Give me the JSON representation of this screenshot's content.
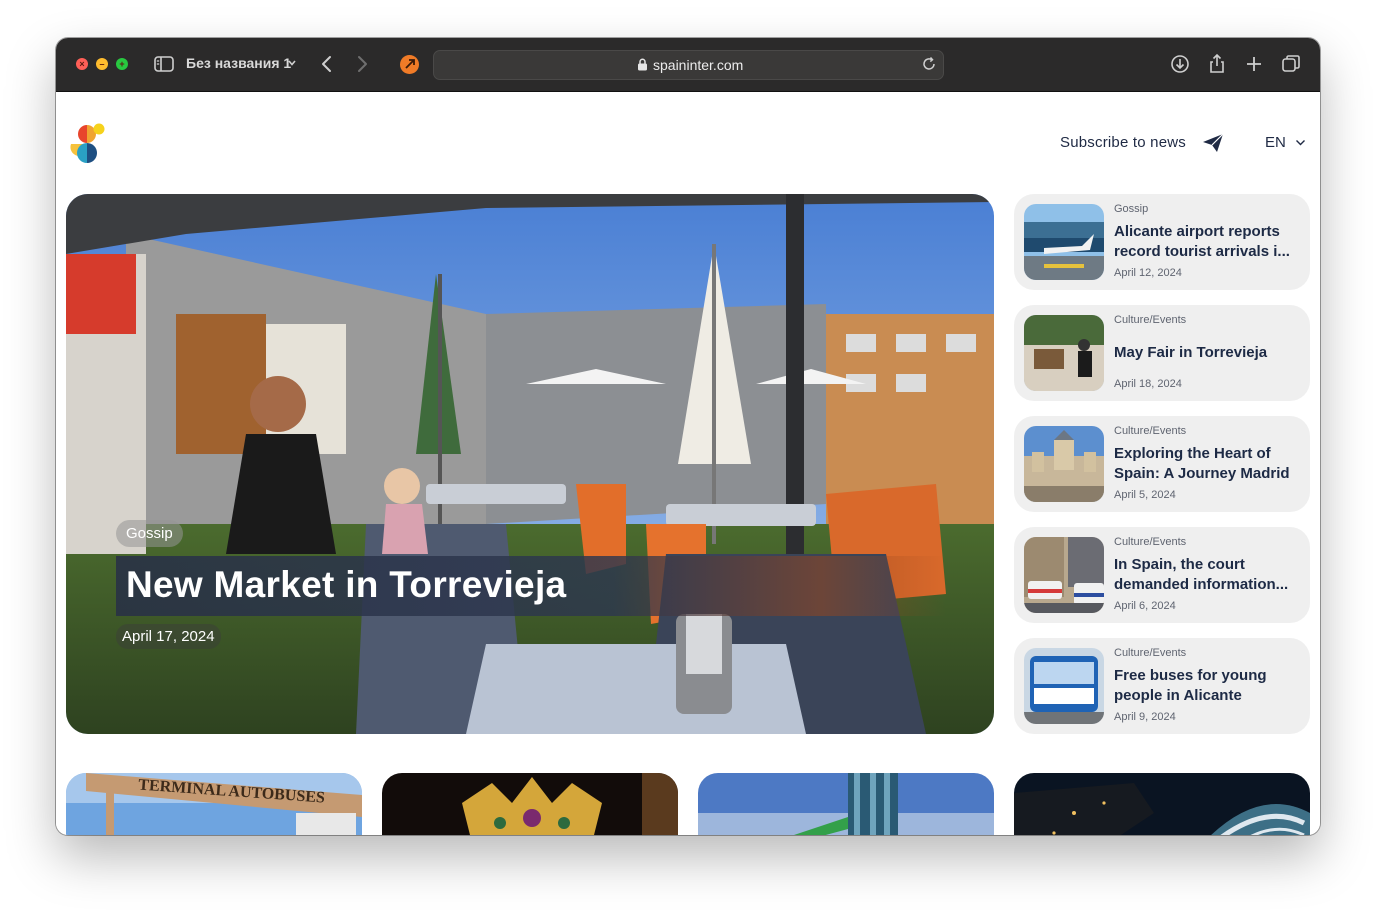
{
  "browser": {
    "tab_title": "Без названия 1",
    "url": "spaininter.com"
  },
  "header": {
    "subscribe_label": "Subscribe to news",
    "language": "EN"
  },
  "hero": {
    "tag": "Gossip",
    "title": "New Market in Torrevieja",
    "date": "April 17, 2024"
  },
  "news": [
    {
      "category": "Gossip",
      "title": "Alicante airport reports record tourist arrivals i...",
      "date": "April 12, 2024"
    },
    {
      "category": "Culture/Events",
      "title": "May Fair in Torrevieja",
      "date": "April 18, 2024"
    },
    {
      "category": "Culture/Events",
      "title": "Exploring the Heart of Spain: A Journey Madrid",
      "date": "April 5, 2024"
    },
    {
      "category": "Culture/Events",
      "title": "In Spain, the court demanded information...",
      "date": "April 6, 2024"
    },
    {
      "category": "Culture/Events",
      "title": "Free buses for young people in Alicante",
      "date": "April 9, 2024"
    }
  ],
  "bottom_cards": {
    "card1_sign": "TERMINAL AUTOBUSES"
  },
  "colors": {
    "titlebar": "#2b2a2a",
    "text_dark": "#1d2a45",
    "card_bg": "#efefef"
  }
}
